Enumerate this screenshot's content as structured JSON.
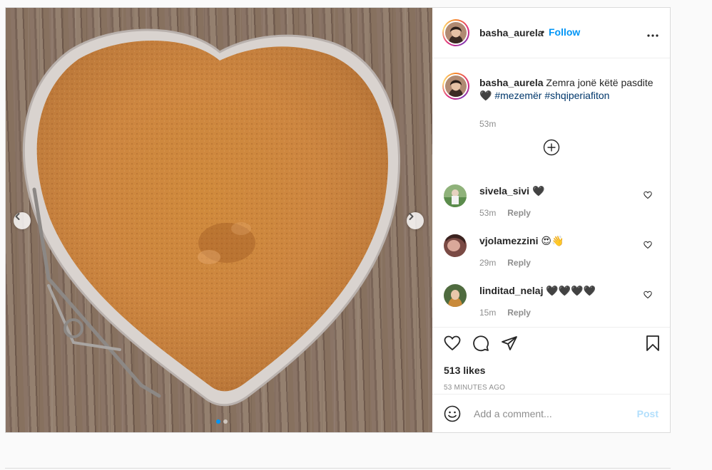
{
  "post": {
    "author": "basha_aurela",
    "follow_label": "Follow",
    "follow_separator": "•",
    "caption": {
      "username": "basha_aurela",
      "text": "Zemra jonë këtë pasdite",
      "emoji": "🖤",
      "hashtags": [
        "#mezemër",
        "#shqiperiafiton"
      ],
      "time": "53m"
    },
    "comments": [
      {
        "username": "sivela_sivi",
        "text": "🖤",
        "time": "53m",
        "reply_label": "Reply"
      },
      {
        "username": "vjolamezzini",
        "text": "😍👋",
        "time": "29m",
        "reply_label": "Reply"
      },
      {
        "username": "linditad_nelaj",
        "text": "🖤🖤🖤🖤",
        "time": "15m",
        "reply_label": "Reply"
      }
    ],
    "likes": "513 likes",
    "posted_ago": "53 MINUTES AGO",
    "comment_placeholder": "Add a comment...",
    "post_label": "Post",
    "carousel": {
      "count": 2,
      "active": 1
    }
  },
  "icons": {
    "more": "more-icon",
    "load_more": "plus-circle-icon",
    "like": "heart-icon",
    "comment": "comment-icon",
    "share": "share-icon",
    "save": "bookmark-icon",
    "emoji": "emoji-icon",
    "prev": "chevron-left-icon",
    "next": "chevron-right-icon"
  },
  "colors": {
    "link": "#0095f6",
    "hashtag": "#00376b",
    "muted": "#8e8e8e",
    "post_disabled": "#b2dffc"
  }
}
